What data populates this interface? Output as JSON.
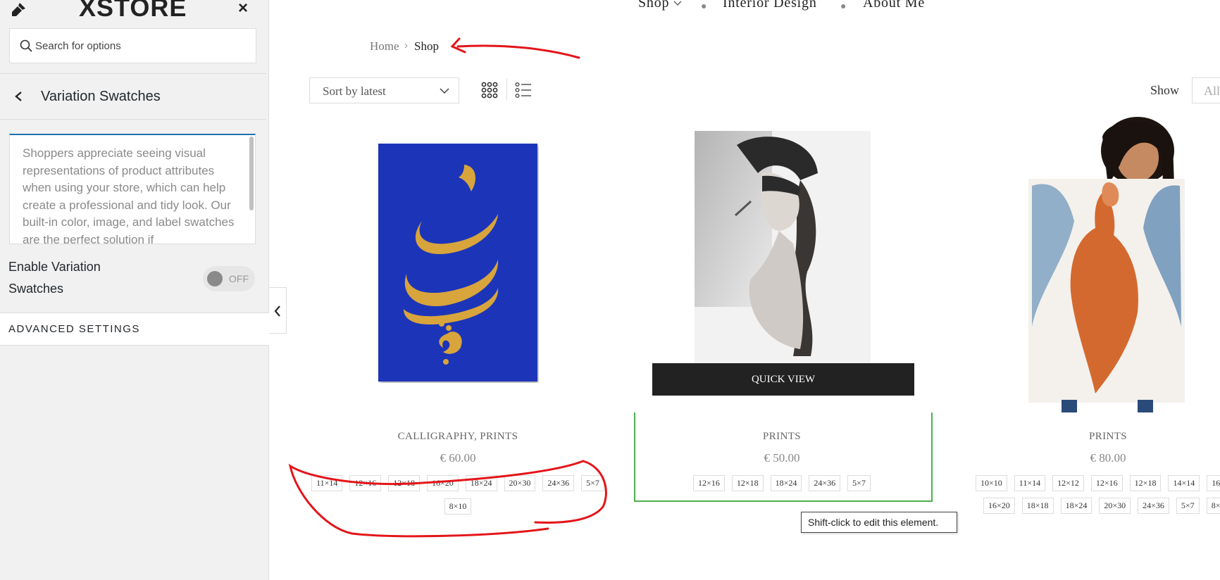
{
  "sidebar": {
    "logo": "XSTORE",
    "close_icon": "×",
    "search": {
      "placeholder": "Search for options",
      "value": ""
    },
    "section_title": "Variation Swatches",
    "description": "Shoppers appreciate seeing visual representations of product attributes when using your store, which can help create a professional and tidy look. Our built-in color, image, and label swatches are the perfect solution if",
    "enable_label_line1": "Enable Variation",
    "enable_label_line2": "Swatches",
    "toggle_state": "OFF",
    "advanced_settings": "ADVANCED SETTINGS"
  },
  "nav": {
    "shop": "Shop",
    "interior": "Interior Design",
    "about": "About Me"
  },
  "breadcrumb": {
    "home": "Home",
    "separator": "›",
    "current": "Shop"
  },
  "toolbar": {
    "sort_label": "Sort by latest",
    "show_label": "Show",
    "show_value": "All"
  },
  "products": [
    {
      "category": "CALLIGRAPHY, PRINTS",
      "price": "€ 60.00",
      "sizes": [
        "11×14",
        "12×16",
        "12×18",
        "16×20",
        "18×24",
        "20×30",
        "24×36",
        "5×7",
        "8×10"
      ]
    },
    {
      "category": "PRINTS",
      "price": "€ 50.00",
      "sizes": [
        "12×16",
        "12×18",
        "18×24",
        "24×36",
        "5×7"
      ],
      "quick_view": "QUICK VIEW"
    },
    {
      "category": "PRINTS",
      "price": "€ 80.00",
      "sizes": [
        "10×10",
        "11×14",
        "12×12",
        "12×16",
        "12×18",
        "14×14",
        "16",
        "16×20",
        "18×18",
        "18×24",
        "20×30",
        "24×36",
        "5×7",
        "8×"
      ]
    }
  ],
  "tooltip": "Shift-click to edit this element.",
  "icons": [
    "brush-icon",
    "close-icon",
    "search-icon",
    "chevron-left-icon",
    "chevron-down-icon",
    "grid-view-icon",
    "list-view-icon",
    "collapse-arrow-icon"
  ],
  "colors": {
    "accent_blue": "#2271b1",
    "highlight_green": "#4caf50",
    "annotation_red": "#e3151a",
    "calligraphy_bg": "#1a36b8",
    "calligraphy_gold": "#d8a43c"
  }
}
